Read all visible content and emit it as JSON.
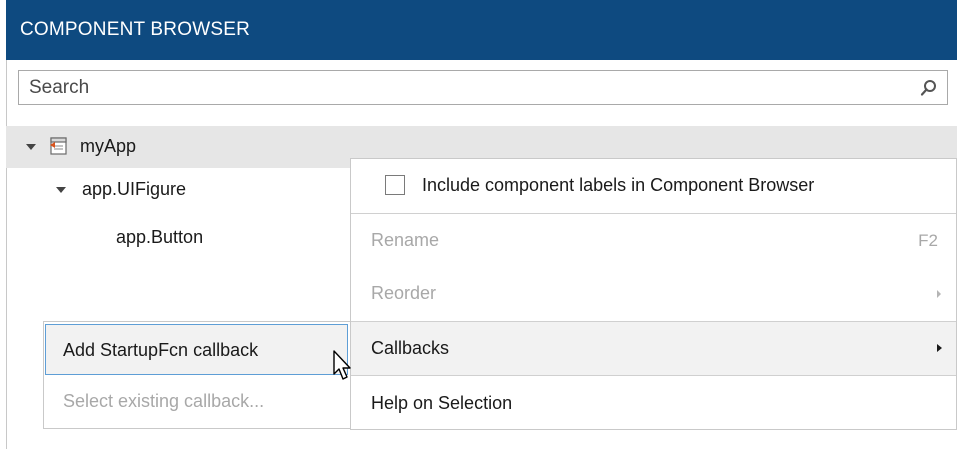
{
  "header": {
    "title": "COMPONENT BROWSER"
  },
  "search": {
    "placeholder": "Search",
    "icon": "search-icon"
  },
  "tree": {
    "root": {
      "label": "myApp",
      "icon": "app-icon"
    },
    "figure": {
      "label": "app.UIFigure"
    },
    "button": {
      "label": "app.Button"
    }
  },
  "context_menu": {
    "include_labels": {
      "label": "Include component labels in Component Browser",
      "checked": false
    },
    "rename": {
      "label": "Rename",
      "shortcut": "F2",
      "enabled": false
    },
    "reorder": {
      "label": "Reorder",
      "enabled": false
    },
    "callbacks": {
      "label": "Callbacks",
      "enabled": true
    },
    "help": {
      "label": "Help on Selection",
      "enabled": true
    }
  },
  "callbacks_submenu": {
    "add": {
      "label": "Add StartupFcn callback",
      "enabled": true
    },
    "select": {
      "label": "Select existing callback...",
      "enabled": false
    }
  },
  "colors": {
    "header_bg": "#0e4a80",
    "header_text": "#ffffff",
    "selected_row_bg": "#e6e6e6",
    "hover_row_bg": "#f2f2f2",
    "focus_border": "#5e9ed6",
    "disabled_text": "#a8a8a8"
  }
}
